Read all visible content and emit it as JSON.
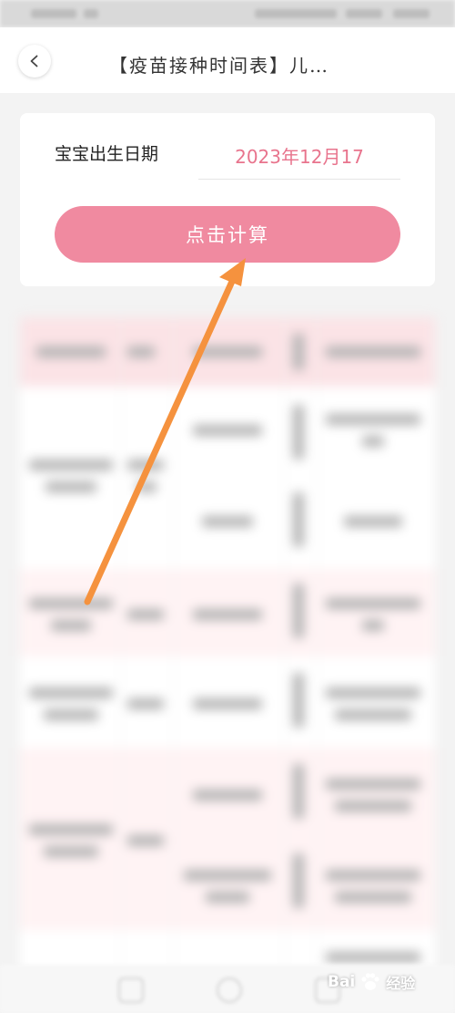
{
  "header": {
    "title": "【疫苗接种时间表】儿…"
  },
  "form": {
    "dob_label": "宝宝出生日期",
    "dob_value": "2023年12月17",
    "calc_button": "点击计算"
  },
  "annotation": {
    "arrow_color": "#f5923e"
  },
  "watermark": {
    "brand": "Bai",
    "suffix": "经验"
  },
  "colors": {
    "accent": "#f08aa0",
    "date_text": "#e8748d"
  }
}
